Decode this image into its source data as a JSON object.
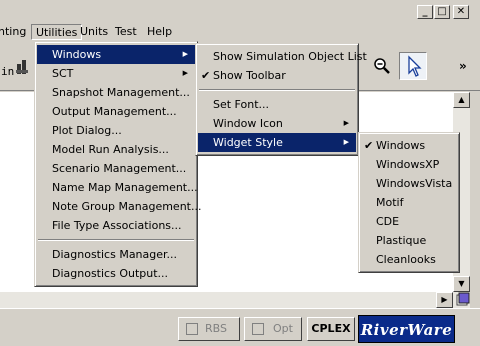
{
  "menubar": {
    "items": [
      {
        "label": "nting"
      },
      {
        "label": "Utilities"
      },
      {
        "label": "Units"
      },
      {
        "label": "Test"
      },
      {
        "label": "Help"
      }
    ]
  },
  "title_buttons": {
    "minimize": "_",
    "restore": "□",
    "close": "✕"
  },
  "toolbar": {
    "left_text": "in",
    "more": "»"
  },
  "utilities_menu": {
    "items": [
      {
        "label": "Windows"
      },
      {
        "label": "SCT"
      },
      {
        "label": "Snapshot Management..."
      },
      {
        "label": "Output Management..."
      },
      {
        "label": "Plot Dialog..."
      },
      {
        "label": "Model Run Analysis..."
      },
      {
        "label": "Scenario Management..."
      },
      {
        "label": "Name Map Management..."
      },
      {
        "label": "Note Group Management..."
      },
      {
        "label": "File Type Associations..."
      },
      {
        "label": "Diagnostics Manager..."
      },
      {
        "label": "Diagnostics Output..."
      }
    ]
  },
  "windows_menu": {
    "items": [
      {
        "label": "Show Simulation Object List"
      },
      {
        "label": "Show Toolbar",
        "checked": true
      },
      {
        "label": "Set Font..."
      },
      {
        "label": "Window Icon"
      },
      {
        "label": "Widget Style"
      }
    ]
  },
  "style_menu": {
    "items": [
      {
        "label": "Windows",
        "checked": true
      },
      {
        "label": "WindowsXP"
      },
      {
        "label": "WindowsVista"
      },
      {
        "label": "Motif"
      },
      {
        "label": "CDE"
      },
      {
        "label": "Plastique"
      },
      {
        "label": "Cleanlooks"
      }
    ]
  },
  "statusbar": {
    "rbs": "RBS",
    "opt": "Opt",
    "cplex": "CPLEX",
    "logo": "RiverWare"
  },
  "colors": {
    "highlight": "#0a246a",
    "face": "#d4d0c8"
  }
}
